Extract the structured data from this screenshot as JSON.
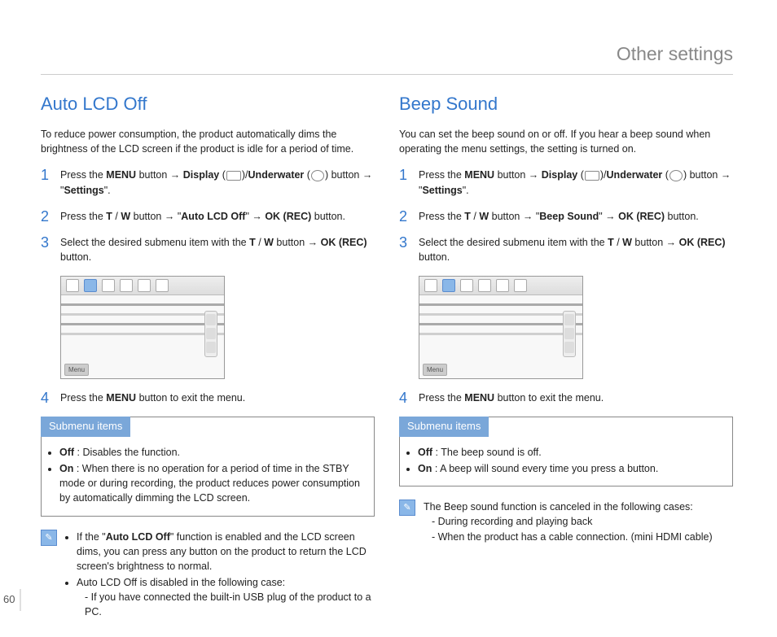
{
  "pageHeader": "Other settings",
  "pageNumber": "60",
  "left": {
    "title": "Auto LCD Off",
    "intro": "To reduce power consumption, the product automatically dims the brightness of the LCD screen if the product is idle for a period of time.",
    "step1_a": "Press the ",
    "step1_b": "MENU",
    "step1_c": " button ",
    "step1_d": "Display",
    "step1_e": "Underwater",
    "step1_f": " button ",
    "step1_g": "Settings",
    "step2_a": "Press the ",
    "step2_b": "T",
    "step2_c": "W",
    "step2_d": " button ",
    "step2_e": "Auto LCD Off",
    "step2_f": "OK (REC)",
    "step2_g": " button.",
    "step3_a": "Select the desired submenu item with the ",
    "step3_b": "T",
    "step3_c": "W",
    "step3_d": " button ",
    "step3_e": "OK (REC)",
    "step3_f": " button.",
    "step4_a": "Press the ",
    "step4_b": "MENU",
    "step4_c": " button to exit the menu.",
    "submenuTitle": "Submenu items",
    "sm_off_l": "Off",
    "sm_off_t": " : Disables the function.",
    "sm_on_l": "On",
    "sm_on_t": " : When there is no operation for a period of time in the STBY mode or during recording, the product reduces power consumption by automatically dimming the LCD screen.",
    "note1_a": "If the \"",
    "note1_b": "Auto LCD Off",
    "note1_c": "\" function is enabled and the LCD screen dims, you can press any button on the product to return the LCD screen's brightness to normal.",
    "note2_a": "Auto LCD Off is disabled in the following case:",
    "note2_b": "- If you have connected the built-in USB plug of the product to a PC.",
    "menuBtn": "Menu"
  },
  "right": {
    "title": "Beep Sound",
    "intro": "You can set the beep sound on or off. If you hear a beep sound when operating the menu settings, the setting is turned on.",
    "step1_a": "Press the ",
    "step1_b": "MENU",
    "step1_c": " button ",
    "step1_d": "Display",
    "step1_e": "Underwater",
    "step1_f": " button ",
    "step1_g": "Settings",
    "step2_a": "Press the ",
    "step2_b": "T",
    "step2_c": "W",
    "step2_d": " button ",
    "step2_e": "Beep Sound",
    "step2_f": "OK (REC)",
    "step2_g": " button.",
    "step3_a": "Select the desired submenu item with the ",
    "step3_b": "T",
    "step3_c": "W",
    "step3_d": " button ",
    "step3_e": "OK (REC)",
    "step3_f": " button.",
    "step4_a": "Press the ",
    "step4_b": "MENU",
    "step4_c": " button to exit the menu.",
    "submenuTitle": "Submenu items",
    "sm_off_l": "Off",
    "sm_off_t": " : The beep sound is off.",
    "sm_on_l": "On",
    "sm_on_t": " : A beep will sound every time you press a button.",
    "note_a": "The Beep sound function is canceled in the following cases:",
    "note_b": "- During recording and playing back",
    "note_c": "- When the product has a cable connection. (mini HDMI cable)",
    "menuBtn": "Menu"
  }
}
